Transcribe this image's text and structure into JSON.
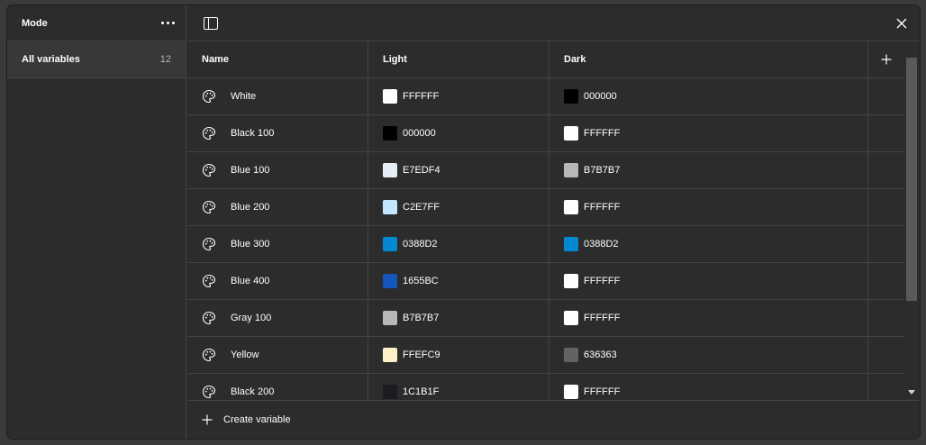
{
  "sidebar": {
    "title": "Mode",
    "more_icon": "more-horizontal-icon",
    "collection": {
      "label": "All variables",
      "count": "12"
    }
  },
  "topbar": {
    "panel_icon": "sidebar-toggle-icon",
    "close_icon": "close-icon"
  },
  "table": {
    "headers": {
      "name": "Name",
      "light": "Light",
      "dark": "Dark",
      "add_icon": "plus-icon"
    },
    "rows": [
      {
        "name": "White",
        "light": "FFFFFF",
        "dark": "000000"
      },
      {
        "name": "Black 100",
        "light": "000000",
        "dark": "FFFFFF"
      },
      {
        "name": "Blue 100",
        "light": "E7EDF4",
        "dark": "B7B7B7"
      },
      {
        "name": "Blue 200",
        "light": "C2E7FF",
        "dark": "FFFFFF"
      },
      {
        "name": "Blue 300",
        "light": "0388D2",
        "dark": "0388D2"
      },
      {
        "name": "Blue 400",
        "light": "1655BC",
        "dark": "FFFFFF"
      },
      {
        "name": "Gray 100",
        "light": "B7B7B7",
        "dark": "FFFFFF"
      },
      {
        "name": "Yellow",
        "light": "FFEFC9",
        "dark": "636363"
      },
      {
        "name": "Black 200",
        "light": "1C1B1F",
        "dark": "FFFFFF"
      }
    ]
  },
  "footer": {
    "create_label": "Create variable",
    "plus_icon": "plus-icon"
  }
}
